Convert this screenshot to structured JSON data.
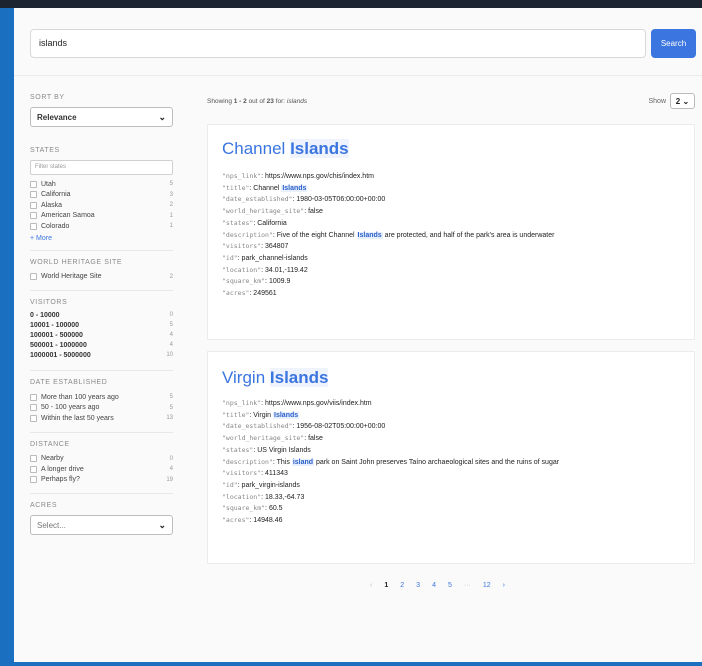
{
  "search": {
    "value": "islands",
    "button_label": "Search"
  },
  "sidebar": {
    "sort_title": "SORT BY",
    "sort_value": "Relevance",
    "states_title": "STATES",
    "states_filter_placeholder": "Filter states",
    "states": [
      {
        "label": "Utah",
        "count": "5"
      },
      {
        "label": "California",
        "count": "3"
      },
      {
        "label": "Alaska",
        "count": "2"
      },
      {
        "label": "American Samoa",
        "count": "1"
      },
      {
        "label": "Colorado",
        "count": "1"
      }
    ],
    "more_label": "+ More",
    "whs_title": "WORLD HERITAGE SITE",
    "whs_option": {
      "label": "World Heritage Site",
      "count": "2"
    },
    "visitors_title": "VISITORS",
    "visitors": [
      {
        "label": "0 - 10000",
        "count": "0"
      },
      {
        "label": "10001 - 100000",
        "count": "5"
      },
      {
        "label": "100001 - 500000",
        "count": "4"
      },
      {
        "label": "500001 - 1000000",
        "count": "4"
      },
      {
        "label": "1000001 - 5000000",
        "count": "10"
      }
    ],
    "established_title": "DATE ESTABLISHED",
    "established": [
      {
        "label": "More than 100 years ago",
        "count": "5"
      },
      {
        "label": "50 - 100 years ago",
        "count": "5"
      },
      {
        "label": "Within the last 50 years",
        "count": "13"
      }
    ],
    "distance_title": "DISTANCE",
    "distance": [
      {
        "label": "Nearby",
        "count": "0"
      },
      {
        "label": "A longer drive",
        "count": "4"
      },
      {
        "label": "Perhaps fly?",
        "count": "19"
      }
    ],
    "acres_title": "ACRES",
    "acres_placeholder": "Select..."
  },
  "results_header": {
    "showing_prefix": "Showing ",
    "range": "1 - 2",
    "out_of": " out of ",
    "total": "23",
    "for_label": " for: ",
    "query": "islands",
    "show_label": "Show",
    "show_value": "2"
  },
  "results": [
    {
      "title_plain": "Channel ",
      "title_hl": "Islands",
      "nps_link": "https://www.nps.gov/chis/index.htm",
      "title_field_plain": "Channel ",
      "title_field_hl": "Islands",
      "date_established": "1980-03-05T06:00:00+00:00",
      "world_heritage_site": "false",
      "states": "California",
      "desc_pre": "Five of the eight Channel ",
      "desc_hl": "Islands",
      "desc_post": " are protected, and half of the park's area is underwater",
      "visitors": "364807",
      "id": "park_channel-islands",
      "location": "34.01,-119.42",
      "square_km": "1009.9",
      "acres": "249561"
    },
    {
      "title_plain": "Virgin ",
      "title_hl": "Islands",
      "nps_link": "https://www.nps.gov/viis/index.htm",
      "title_field_plain": "Virgin ",
      "title_field_hl": "Islands",
      "date_established": "1956-08-02T05:00:00+00:00",
      "world_heritage_site": "false",
      "states": "US Virgin Islands",
      "desc_pre": "This ",
      "desc_hl": "island",
      "desc_post": " park on Saint John preserves Taíno archaeological sites and the ruins of sugar",
      "visitors": "411343",
      "id": "park_virgin-islands",
      "location": "18.33,-64.73",
      "square_km": "60.5",
      "acres": "14948.46"
    }
  ],
  "field_keys": {
    "nps_link": "\"nps_link\"",
    "title": "\"title\"",
    "date_established": "\"date_established\"",
    "world_heritage_site": "\"world_heritage_site\"",
    "states": "\"states\"",
    "description": "\"description\"",
    "visitors": "\"visitors\"",
    "id": "\"id\"",
    "location": "\"location\"",
    "square_km": "\"square_km\"",
    "acres": "\"acres\""
  },
  "pagination": {
    "prev": "‹",
    "pages": [
      "1",
      "2",
      "3",
      "4",
      "5"
    ],
    "ellipsis": "···",
    "last": "12",
    "next": "›"
  }
}
